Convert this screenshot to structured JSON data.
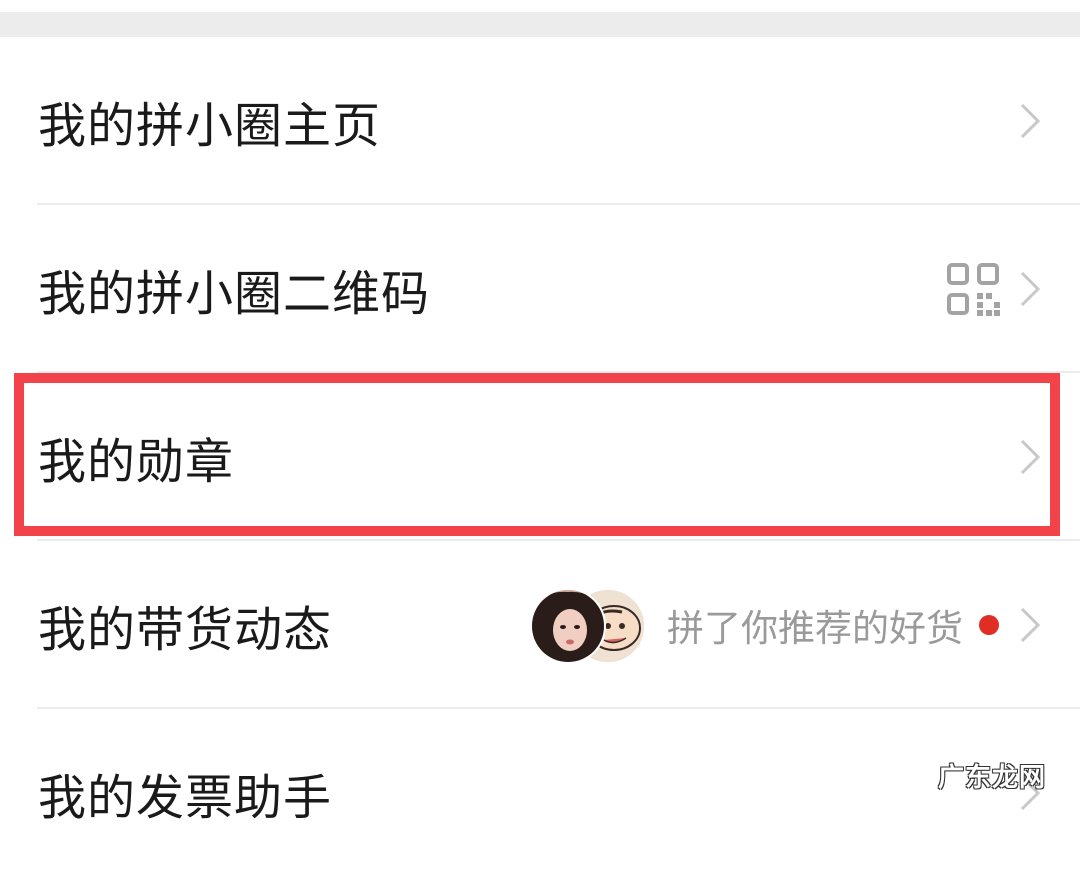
{
  "menu": {
    "items": [
      {
        "label": "我的拼小圈主页"
      },
      {
        "label": "我的拼小圈二维码"
      },
      {
        "label": "我的勋章"
      },
      {
        "label": "我的带货动态",
        "activity_text": "拼了你推荐的好货"
      },
      {
        "label": "我的发票助手"
      }
    ]
  },
  "watermark": "广东龙网",
  "colors": {
    "highlight_border": "#f2434a",
    "notification_dot": "#e02e24",
    "top_band": "#ececec"
  },
  "icons": {
    "chevron": "chevron-right-icon",
    "qr": "qr-code-icon"
  }
}
